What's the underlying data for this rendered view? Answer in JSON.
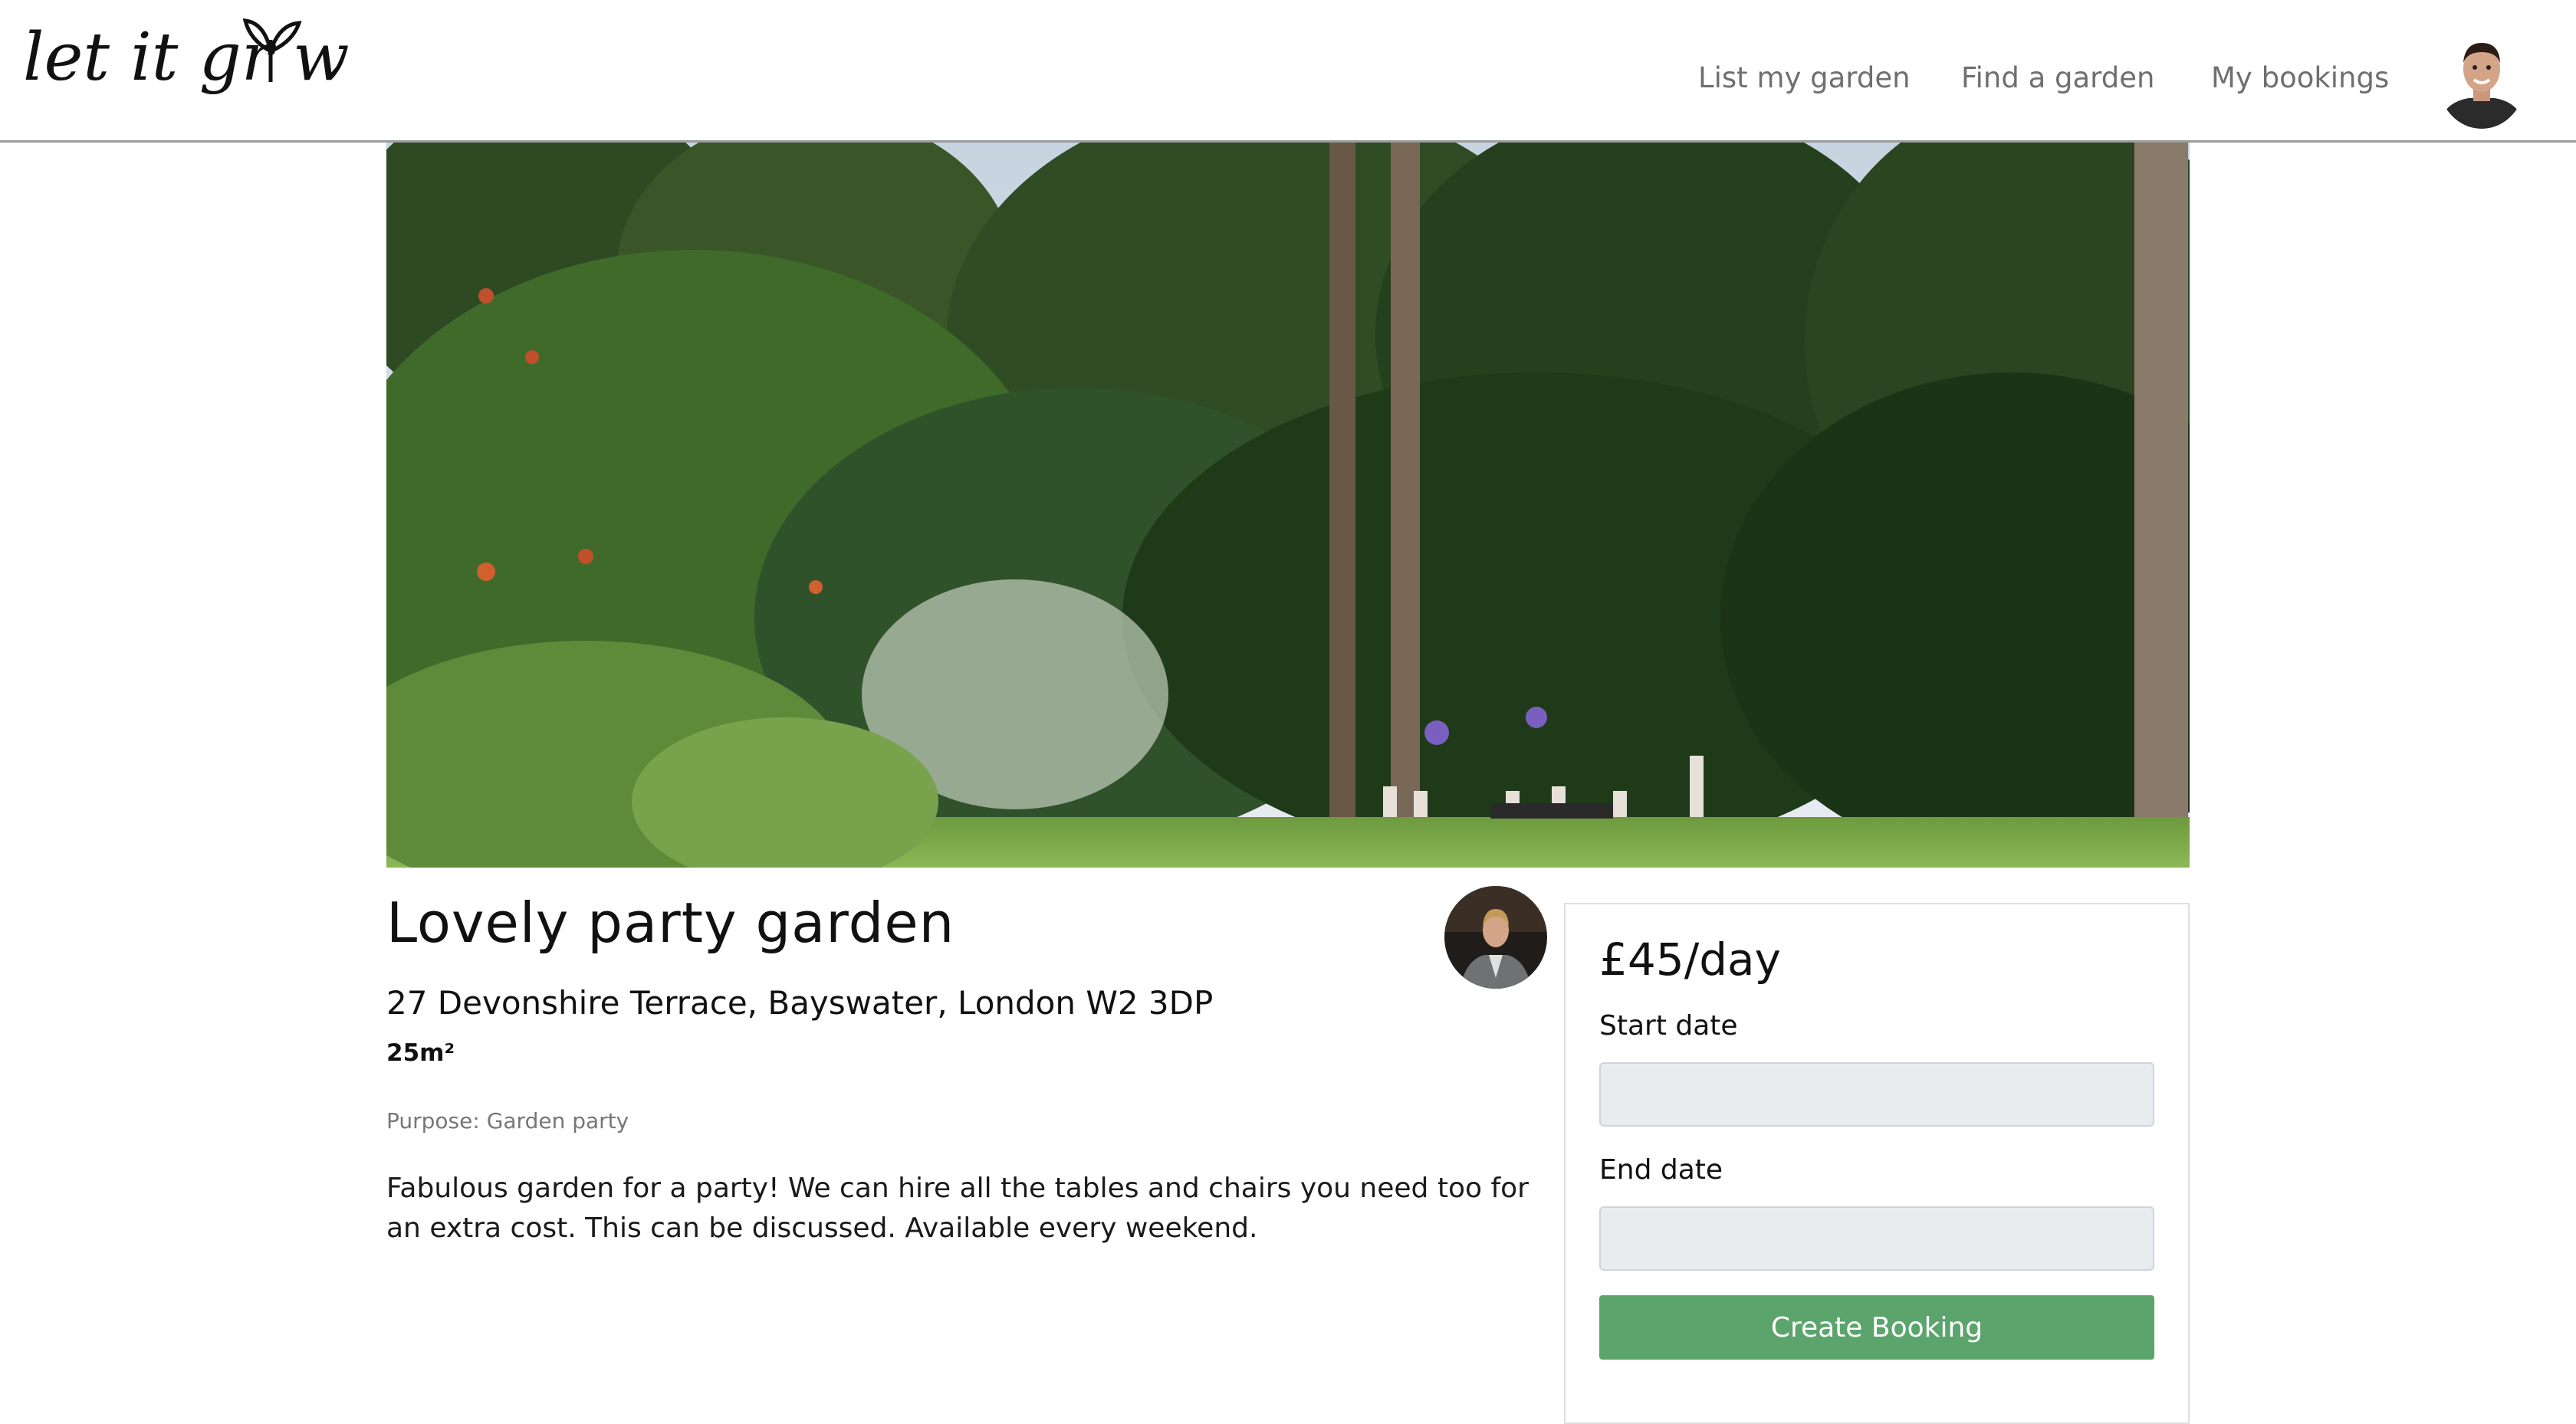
{
  "brand": {
    "logo_text": "let it grow"
  },
  "nav": {
    "items": [
      {
        "label": "List my garden"
      },
      {
        "label": "Find a garden"
      },
      {
        "label": "My bookings"
      }
    ]
  },
  "listing": {
    "title": "Lovely party garden",
    "address": "27 Devonshire Terrace, Bayswater, London W2 3DP",
    "size": "25m²",
    "purpose": "Purpose: Garden party",
    "description": "Fabulous garden for a party! We can hire all the tables and chairs you need too for an extra cost. This can be discussed. Available every weekend."
  },
  "booking": {
    "price": "£45/day",
    "start_label": "Start date",
    "start_value": "",
    "end_label": "End date",
    "end_value": "",
    "button_label": "Create Booking"
  },
  "colors": {
    "accent_green": "#5ba56d",
    "nav_text": "#6f6f6f",
    "input_bg": "#e9ecef"
  }
}
